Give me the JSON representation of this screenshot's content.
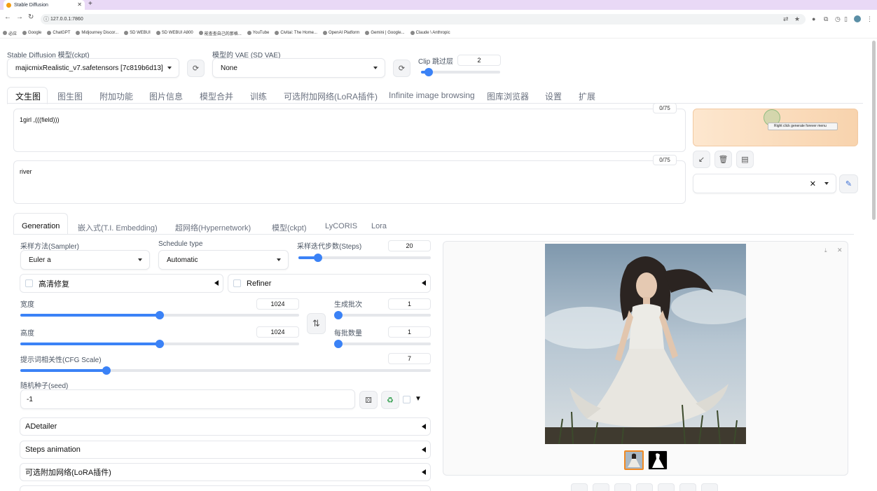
{
  "browser": {
    "tab_title": "Stable Diffusion",
    "url": "127.0.0.1:7860",
    "bookmarks": [
      "必应",
      "Google",
      "ChatGPT",
      "Midjourney Discor...",
      "SD WEBUI",
      "SD WEBUI A800",
      "能查查自己的那格...",
      "YouTube",
      "Civitai: The Home...",
      "OpenAI Platform",
      "Gemini | Google...",
      "Claude \\ Anthropic"
    ]
  },
  "header": {
    "model_label": "Stable Diffusion 模型(ckpt)",
    "model_value": "majicmixRealistic_v7.safetensors [7c819b6d13]",
    "vae_label": "模型的 VAE (SD VAE)",
    "vae_value": "None",
    "clip_label": "Clip 跳过层",
    "clip_value": "2",
    "clip_fraction": 0.1
  },
  "main_tabs": [
    "文生图",
    "图生图",
    "附加功能",
    "图片信息",
    "模型合并",
    "训练",
    "可选附加网络(LoRA插件)",
    "Infinite image browsing",
    "图库浏览器",
    "设置",
    "扩展"
  ],
  "prompt": {
    "positive": "1girl ,(((field)))",
    "positive_counter": "0/75",
    "negative": "river",
    "negative_counter": "0/75",
    "tooltip": "Right click generate forever menu"
  },
  "sub_tabs": [
    "Generation",
    "嵌入式(T.I. Embedding)",
    "超网络(Hypernetwork)",
    "模型(ckpt)",
    "LyCORIS",
    "Lora"
  ],
  "generation": {
    "sampler_label": "采样方法(Sampler)",
    "sampler_value": "Euler a",
    "schedule_label": "Schedule type",
    "schedule_value": "Automatic",
    "steps_label": "采样迭代步数(Steps)",
    "steps_value": "20",
    "steps_fraction": 0.15,
    "hires_label": "高清修复",
    "refiner_label": "Refiner",
    "width_label": "宽度",
    "width_value": "1024",
    "width_fraction": 0.5,
    "height_label": "高度",
    "height_value": "1024",
    "height_fraction": 0.5,
    "batch_count_label": "生成批次",
    "batch_count_value": "1",
    "batch_size_label": "每批数量",
    "batch_size_value": "1",
    "cfg_label": "提示词相关性(CFG Scale)",
    "cfg_value": "7",
    "cfg_fraction": 0.21,
    "seed_label": "随机种子(seed)",
    "seed_value": "-1"
  },
  "accordions": [
    "ADetailer",
    "Steps animation",
    "可选附加网络(LoRA插件)"
  ],
  "colors": {
    "accent": "#3b82f6",
    "generate_bg": "#f8d3ad"
  }
}
